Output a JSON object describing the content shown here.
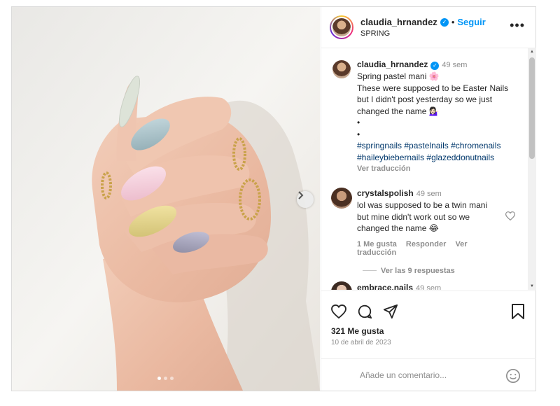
{
  "header": {
    "username": "claudia_hrnandez",
    "separator": "•",
    "follow_label": "Seguir",
    "subtitle": "SPRING",
    "more_label": "•••"
  },
  "caption": {
    "username": "claudia_hrnandez",
    "time": "49 sem",
    "line1": "Spring pastel mani 🌸",
    "line2": "These were supposed to be Easter Nails",
    "line3": "but I didn't post yesterday so we just",
    "line4": "changed the name 💁🏻‍♀️",
    "bullet1": "•",
    "bullet2": "•",
    "hashtags1": "#springnails #pastelnails #chromenails",
    "hashtags2": "#haileybiebernails #glazeddonutnails",
    "translate": "Ver traducción"
  },
  "comment1": {
    "username": "crystalspolish",
    "time": "49 sem",
    "line1": "lol was supposed to be a twin mani",
    "line2": "but mine didn't work out so we",
    "line3": "changed the name 😂",
    "likes": "1 Me gusta",
    "reply": "Responder",
    "translate": "Ver traducción",
    "view_replies": "Ver las 9 respuestas"
  },
  "comment2": {
    "username": "embrace.nails",
    "time": "49 sem"
  },
  "post": {
    "likes": "321 Me gusta",
    "date": "10 de abril de 2023",
    "add_comment_placeholder": "Añade un comentario..."
  },
  "media": {
    "slides": 3,
    "active_slide": 1
  },
  "colors": {
    "accent": "#0095f6",
    "hashtag": "#00376b",
    "muted": "#8e8e8e"
  },
  "icons": [
    "verified-icon",
    "more-options-icon",
    "heart-icon",
    "comment-icon",
    "share-icon",
    "bookmark-icon",
    "emoji-icon",
    "next-arrow-icon"
  ]
}
